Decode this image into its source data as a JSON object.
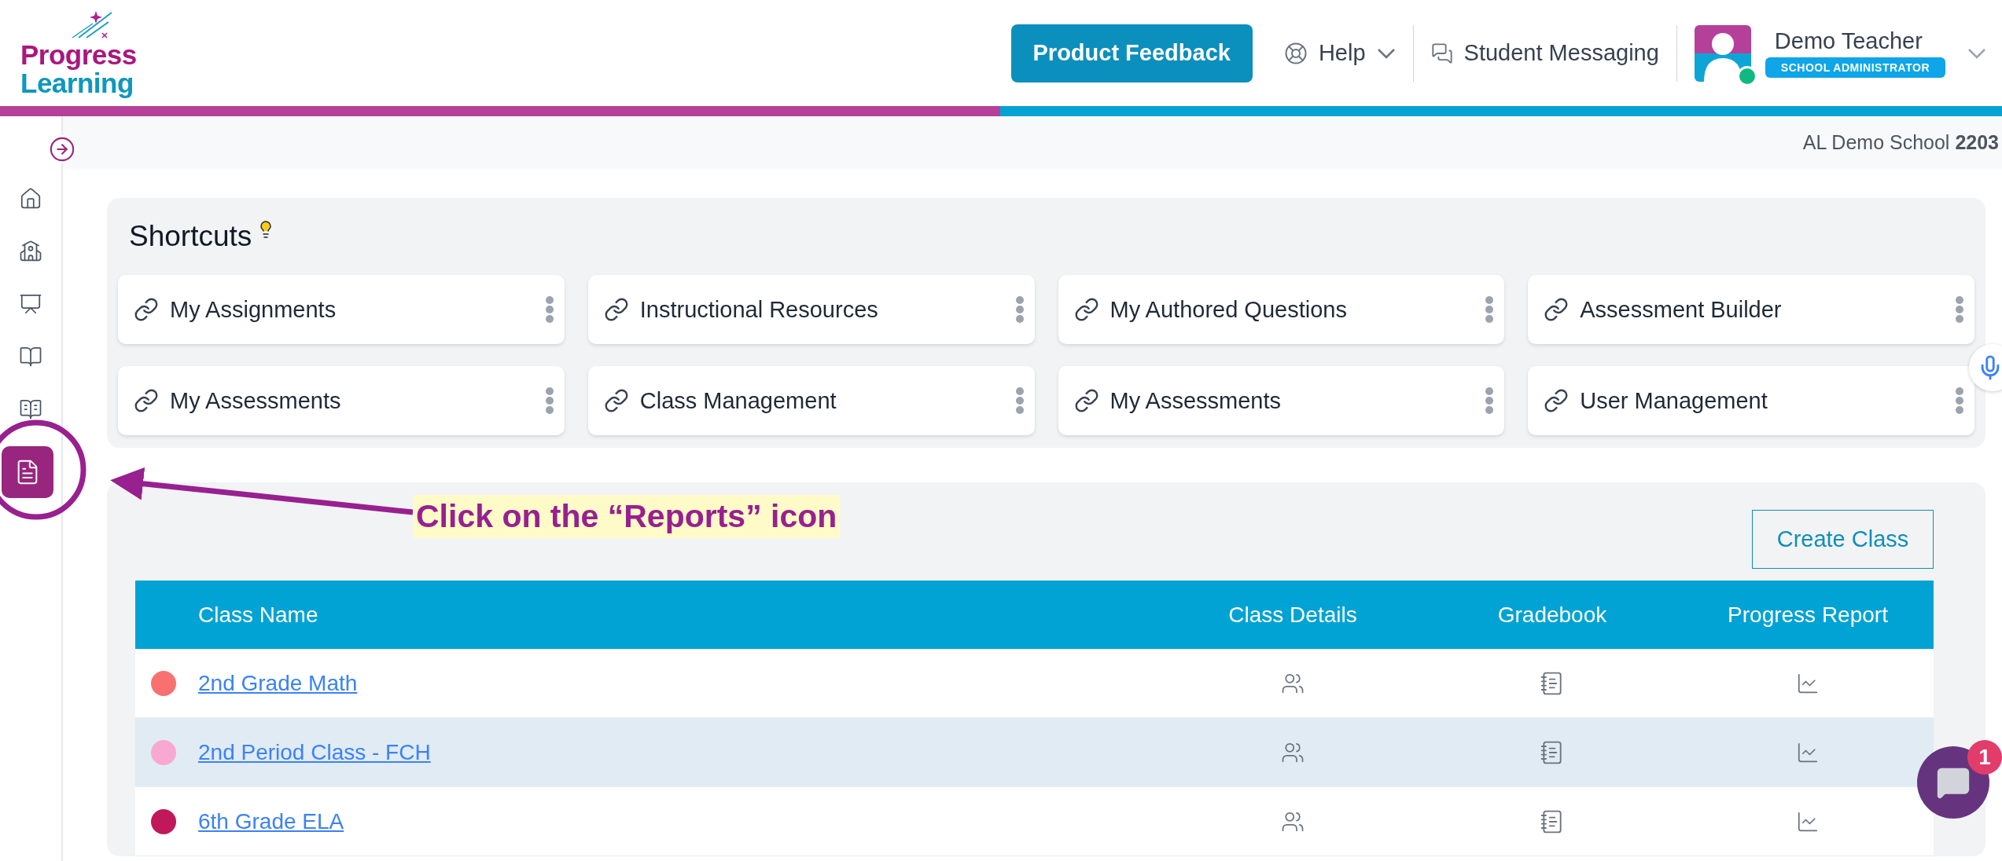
{
  "logo": {
    "line_1": "Progress",
    "line_2": "Learning"
  },
  "header": {
    "feedback_button": "Product Feedback",
    "help": "Help",
    "messaging": "Student Messaging",
    "user": {
      "name": "Demo Teacher",
      "role": "SCHOOL ADMINISTRATOR",
      "online": true
    }
  },
  "school": {
    "name": "AL Demo School",
    "code": "2203"
  },
  "sidebar": {
    "items": [
      {
        "kind": "home",
        "selected": false
      },
      {
        "kind": "school",
        "selected": false
      },
      {
        "kind": "classroom",
        "selected": false
      },
      {
        "kind": "book",
        "selected": false
      },
      {
        "kind": "book-info",
        "selected": false
      },
      {
        "kind": "reports",
        "selected": true
      }
    ]
  },
  "shortcuts": {
    "title": "Shortcuts",
    "items": [
      {
        "label": "My Assignments"
      },
      {
        "label": "Instructional Resources"
      },
      {
        "label": "My Authored Questions"
      },
      {
        "label": "Assessment Builder"
      },
      {
        "label": "My Assessments"
      },
      {
        "label": "Class Management"
      },
      {
        "label": "My Assessments"
      },
      {
        "label": "User Management"
      }
    ]
  },
  "classes": {
    "create_button": "Create Class",
    "columns": [
      "Class Name",
      "Class Details",
      "Gradebook",
      "Progress Report"
    ],
    "rows": [
      {
        "name": "2nd Grade Math",
        "color": "#f87171",
        "selected": false
      },
      {
        "name": "2nd Period Class - FCH",
        "color": "#f9a8d4",
        "selected": true
      },
      {
        "name": "6th Grade ELA",
        "color": "#c0185a",
        "selected": false
      }
    ]
  },
  "annotation": {
    "text": "Click on the “Reports” icon"
  },
  "chat": {
    "badge": "1"
  }
}
